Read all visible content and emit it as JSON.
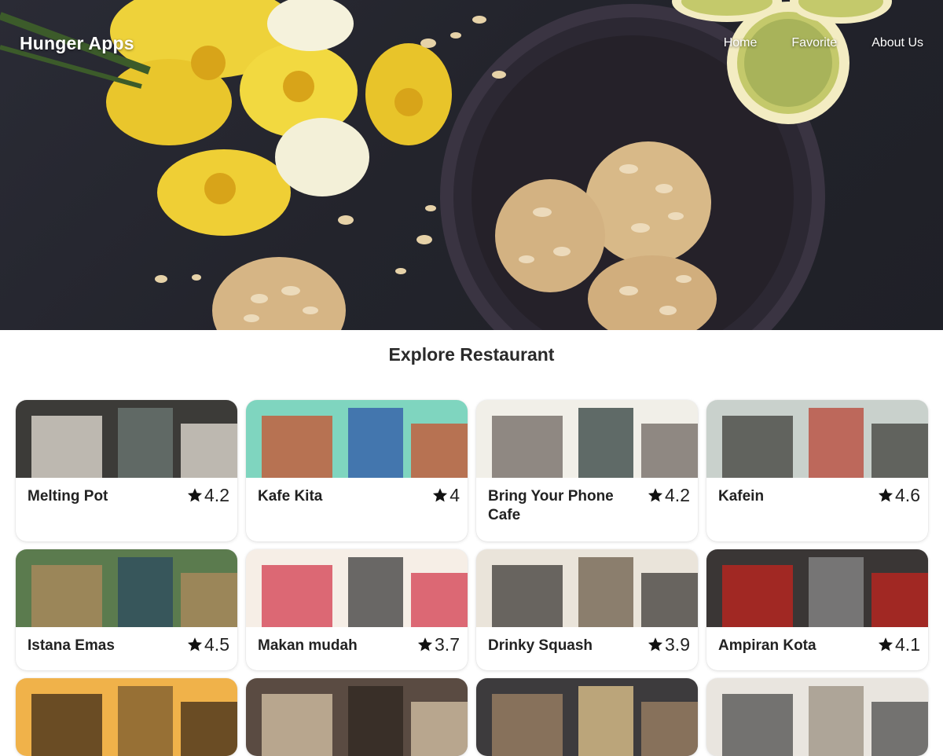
{
  "nav": {
    "brand": "Hunger Apps",
    "links": [
      "Home",
      "Favorite",
      "About Us"
    ]
  },
  "hero": {
    "image": "food-table-photo"
  },
  "section_title": "Explore Restaurant",
  "rating_icon": "star-icon",
  "restaurants": [
    {
      "name": "Melting Pot",
      "rating": "4.2",
      "image": "cafe-counter-photo"
    },
    {
      "name": "Kafe Kita",
      "rating": "4",
      "image": "colorful-storefront-photo"
    },
    {
      "name": "Bring Your Phone Cafe",
      "rating": "4.2",
      "image": "cafe-window-photo"
    },
    {
      "name": "Kafein",
      "rating": "4.6",
      "image": "greenhouse-table-photo"
    },
    {
      "name": "Istana Emas",
      "rating": "4.5",
      "image": "outdoor-terrace-photo"
    },
    {
      "name": "Makan mudah",
      "rating": "3.7",
      "image": "striped-awning-photo"
    },
    {
      "name": "Drinky Squash",
      "rating": "3.9",
      "image": "coffee-bar-photo"
    },
    {
      "name": "Ampiran Kota",
      "rating": "4.1",
      "image": "london-street-photo"
    },
    {
      "name": "",
      "rating": "",
      "image": "bar-interior-photo"
    },
    {
      "name": "",
      "rating": "",
      "image": "kitchen-chefs-photo"
    },
    {
      "name": "",
      "rating": "",
      "image": "night-restaurant-photo"
    },
    {
      "name": "",
      "rating": "",
      "image": "market-street-photo"
    }
  ]
}
